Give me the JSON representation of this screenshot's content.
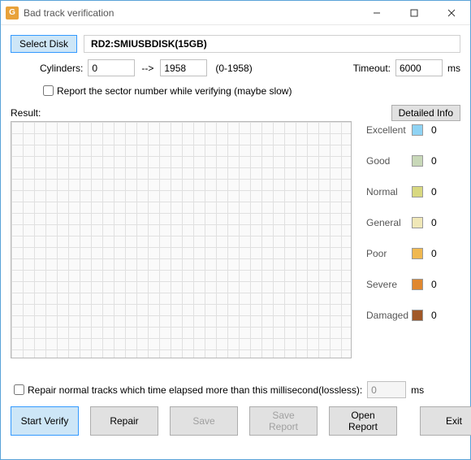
{
  "window": {
    "title": "Bad track verification"
  },
  "toolbar": {
    "select_disk": "Select Disk",
    "disk_name": "RD2:SMIUSBDISK(15GB)"
  },
  "cylinders": {
    "label": "Cylinders:",
    "from": "0",
    "arrow": "-->",
    "to": "1958",
    "range": "(0-1958)"
  },
  "timeout": {
    "label": "Timeout:",
    "value": "6000",
    "unit": "ms"
  },
  "options": {
    "report_sector": "Report the sector number while verifying (maybe slow)",
    "repair_normal": "Repair normal tracks which time elapsed more than this millisecond(lossless):",
    "repair_ms_value": "0",
    "repair_ms_unit": "ms"
  },
  "result": {
    "label": "Result:",
    "detailed_info": "Detailed Info"
  },
  "legend": {
    "items": [
      {
        "label": "Excellent",
        "color": "#8fd3f4",
        "count": "0"
      },
      {
        "label": "Good",
        "color": "#c8d8b8",
        "count": "0"
      },
      {
        "label": "Normal",
        "color": "#d8d880",
        "count": "0"
      },
      {
        "label": "General",
        "color": "#f0e8b8",
        "count": "0"
      },
      {
        "label": "Poor",
        "color": "#f0b850",
        "count": "0"
      },
      {
        "label": "Severe",
        "color": "#e08830",
        "count": "0"
      },
      {
        "label": "Damaged",
        "color": "#a05828",
        "count": "0"
      }
    ]
  },
  "buttons": {
    "start_verify": "Start Verify",
    "repair": "Repair",
    "save": "Save",
    "save_report": "Save Report",
    "open_report": "Open Report",
    "exit": "Exit"
  }
}
